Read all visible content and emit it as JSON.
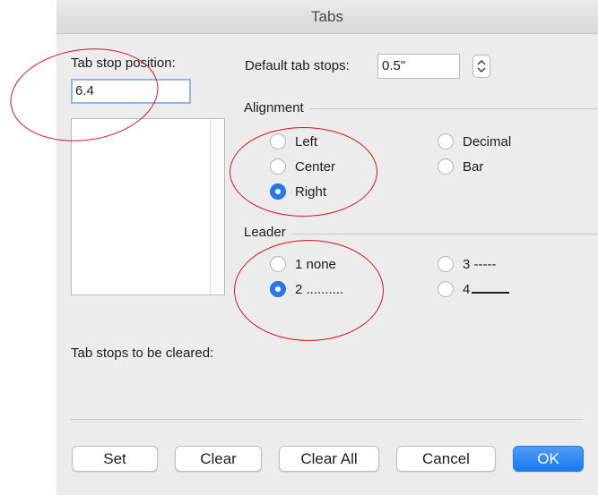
{
  "window": {
    "title": "Tabs"
  },
  "tab_stop": {
    "label": "Tab stop position:",
    "value": "6.4"
  },
  "default_tab_stops": {
    "label": "Default tab stops:",
    "value": "0.5\""
  },
  "alignment": {
    "label": "Alignment",
    "options": [
      "Left",
      "Center",
      "Right",
      "Decimal",
      "Bar"
    ],
    "selected": "Right"
  },
  "leader": {
    "label": "Leader",
    "options": [
      "1 none",
      "2 ..........",
      "3 -----",
      "4"
    ],
    "selected": "2 .........."
  },
  "cleared": {
    "label": "Tab stops to be cleared:"
  },
  "buttons": {
    "set": "Set",
    "clear": "Clear",
    "clear_all": "Clear All",
    "cancel": "Cancel",
    "ok": "OK"
  },
  "colors": {
    "accent": "#2c78e7",
    "annotation": "#d7141a"
  }
}
